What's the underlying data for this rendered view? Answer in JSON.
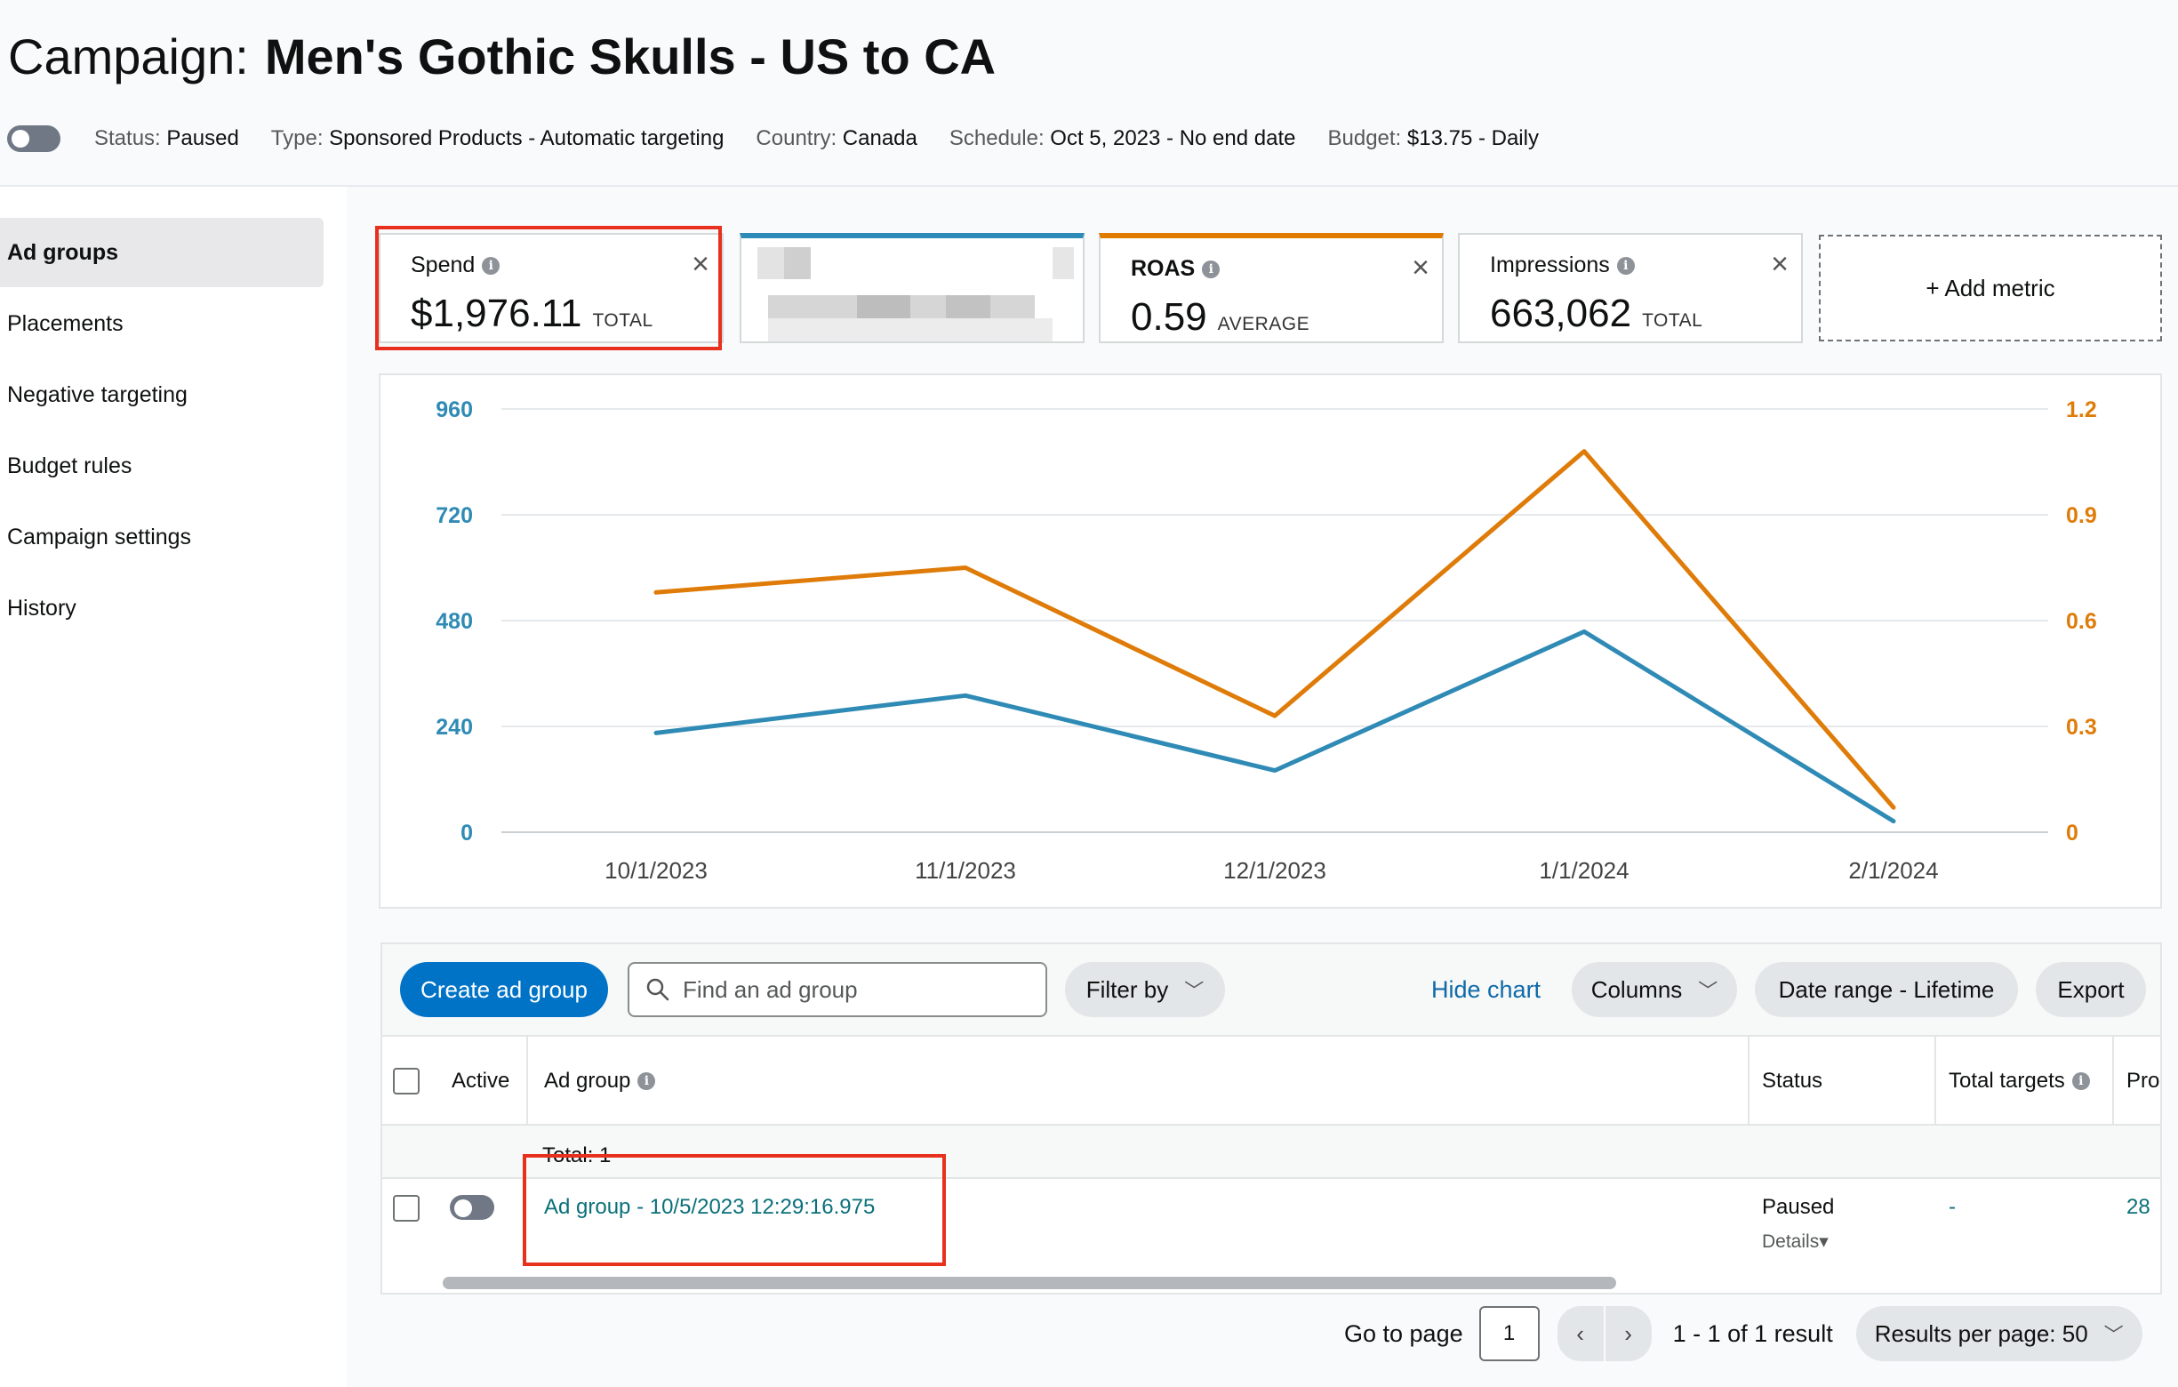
{
  "campaign": {
    "prefix": "Campaign:",
    "name": "Men's Gothic Skulls - US to CA",
    "status_label": "Status:",
    "status_value": "Paused",
    "type_label": "Type:",
    "type_value": "Sponsored Products - Automatic targeting",
    "country_label": "Country:",
    "country_value": "Canada",
    "schedule_label": "Schedule:",
    "schedule_value": "Oct 5, 2023 - No end date",
    "budget_label": "Budget:",
    "budget_value": "$13.75 - Daily"
  },
  "sidebar": {
    "items": [
      {
        "label": "Ad groups",
        "active": true
      },
      {
        "label": "Placements"
      },
      {
        "label": "Negative targeting"
      },
      {
        "label": "Budget rules"
      },
      {
        "label": "Campaign settings"
      },
      {
        "label": "History"
      }
    ]
  },
  "metrics": {
    "spend": {
      "label": "Spend",
      "value": "$1,976.11",
      "unit": "TOTAL"
    },
    "roas": {
      "label": "ROAS",
      "value": "0.59",
      "unit": "AVERAGE"
    },
    "impressions": {
      "label": "Impressions",
      "value": "663,062",
      "unit": "TOTAL"
    },
    "add_label": "+ Add metric"
  },
  "chart_data": {
    "type": "line",
    "x": [
      "10/1/2023",
      "11/1/2023",
      "12/1/2023",
      "1/1/2024",
      "2/1/2024"
    ],
    "series": [
      {
        "axis": "left",
        "color": "#2f8bb5",
        "values": [
          225,
          310,
          140,
          455,
          25
        ]
      },
      {
        "axis": "right",
        "color": "#df7c09",
        "values": [
          0.68,
          0.75,
          0.33,
          1.08,
          0.07
        ]
      }
    ],
    "y_left": {
      "ticks": [
        "960",
        "720",
        "480",
        "240",
        "0"
      ],
      "range": [
        0,
        960
      ],
      "color": "#2f8bb5"
    },
    "y_right": {
      "ticks": [
        "1.2",
        "0.9",
        "0.6",
        "0.3",
        "0"
      ],
      "range": [
        0,
        1.2
      ],
      "color": "#df7c09"
    },
    "grid": true
  },
  "toolbar": {
    "create_label": "Create ad group",
    "search_placeholder": "Find an ad group",
    "filter_label": "Filter by",
    "hide_chart_label": "Hide chart",
    "columns_label": "Columns",
    "date_range_label": "Date range - Lifetime",
    "export_label": "Export"
  },
  "table": {
    "headers": {
      "active": "Active",
      "ad_group": "Ad group",
      "status": "Status",
      "total_targets": "Total targets",
      "products": "Pro"
    },
    "total_label": "Total: 1",
    "row": {
      "name": "Ad group - 10/5/2023 12:29:16.975",
      "status": "Paused",
      "details": "Details",
      "total_targets": "-",
      "products": "28"
    }
  },
  "pagination": {
    "goto_label": "Go to page",
    "page": "1",
    "result_text": "1 - 1 of 1 result",
    "per_page_label": "Results per page: 50"
  },
  "icons": {
    "close": "close-icon",
    "info": "info-icon",
    "search": "search-icon",
    "chevron": "chevron-down-icon"
  }
}
